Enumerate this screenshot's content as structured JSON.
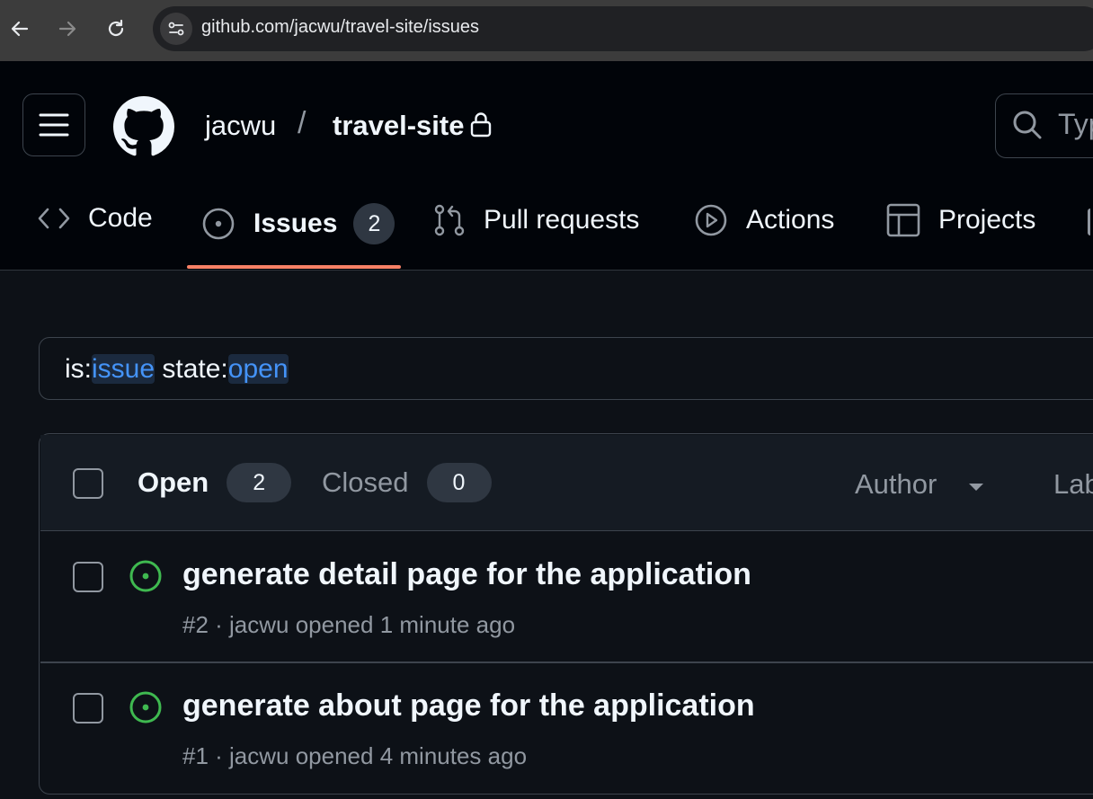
{
  "browser": {
    "url": "github.com/jacwu/travel-site/issues"
  },
  "header": {
    "owner": "jacwu",
    "separator": "/",
    "repo": "travel-site",
    "search_placeholder": "Typ"
  },
  "tabs": [
    {
      "label": "Code",
      "icon": "code-icon"
    },
    {
      "label": "Issues",
      "icon": "issue-opened-icon",
      "count": "2",
      "selected": true
    },
    {
      "label": "Pull requests",
      "icon": "git-pull-request-icon"
    },
    {
      "label": "Actions",
      "icon": "play-icon"
    },
    {
      "label": "Projects",
      "icon": "table-icon"
    }
  ],
  "filter": {
    "prefix1": "is:",
    "value1": "issue",
    "prefix2": " state:",
    "value2": "open"
  },
  "issues_header": {
    "open_label": "Open",
    "open_count": "2",
    "closed_label": "Closed",
    "closed_count": "0",
    "author_label": "Author",
    "labels_label": "Lab"
  },
  "issues": [
    {
      "title": "generate detail page for the application",
      "meta": "#2 · jacwu opened 1 minute ago"
    },
    {
      "title": "generate about page for the application",
      "meta": "#1 · jacwu opened 4 minutes ago"
    }
  ],
  "colors": {
    "accent_underline": "#f78166",
    "open_issue": "#3fb950",
    "link_blue": "#4493f8"
  }
}
